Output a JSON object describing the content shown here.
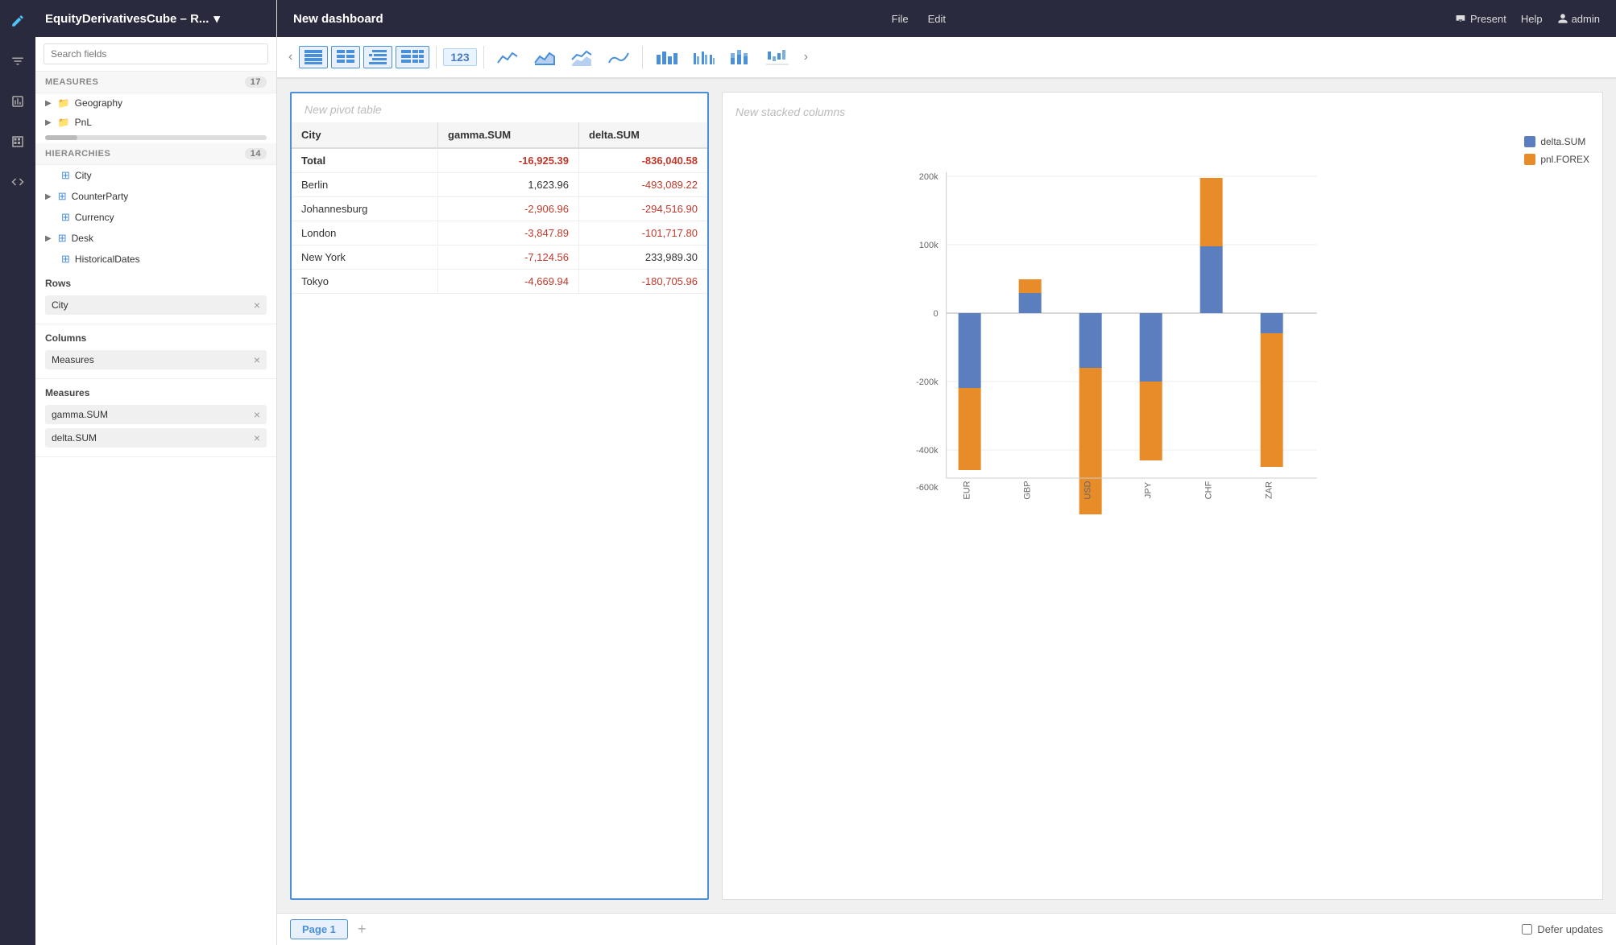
{
  "app": {
    "title": "New dashboard",
    "nav": {
      "file": "File",
      "edit": "Edit"
    },
    "top_right": {
      "present": "Present",
      "help": "Help",
      "admin": "admin"
    }
  },
  "sidebar": {
    "cube_name": "EquityDerivativesCube – R...",
    "search_placeholder": "Search fields",
    "measures_section": {
      "label": "MEASURES",
      "count": 17
    },
    "measures_items": [
      {
        "label": "Geography",
        "type": "folder",
        "expandable": true
      },
      {
        "label": "PnL",
        "type": "folder",
        "expandable": true
      }
    ],
    "hierarchies_section": {
      "label": "HIERARCHIES",
      "count": 14
    },
    "hierarchies_items": [
      {
        "label": "City",
        "type": "hierarchy",
        "expandable": false
      },
      {
        "label": "CounterParty",
        "type": "hierarchy",
        "expandable": true
      },
      {
        "label": "Currency",
        "type": "hierarchy",
        "expandable": false
      },
      {
        "label": "Desk",
        "type": "hierarchy",
        "expandable": true
      },
      {
        "label": "HistoricalDates",
        "type": "hierarchy",
        "expandable": false
      }
    ],
    "rows_section": {
      "title": "Rows",
      "chips": [
        {
          "label": "City"
        }
      ]
    },
    "columns_section": {
      "title": "Columns",
      "chips": [
        {
          "label": "Measures"
        }
      ]
    },
    "measures_chips_section": {
      "title": "Measures",
      "chips": [
        {
          "label": "gamma.SUM"
        },
        {
          "label": "delta.SUM"
        }
      ]
    }
  },
  "pivot": {
    "title": "New pivot table",
    "columns": [
      "City",
      "gamma.SUM",
      "delta.SUM"
    ],
    "rows": [
      {
        "city": "Total",
        "gamma": "-16,925.39",
        "delta": "-836,040.58",
        "gamma_neg": true,
        "delta_neg": true
      },
      {
        "city": "Berlin",
        "gamma": "1,623.96",
        "delta": "-493,089.22",
        "gamma_neg": false,
        "delta_neg": true
      },
      {
        "city": "Johannesburg",
        "gamma": "-2,906.96",
        "delta": "-294,516.90",
        "gamma_neg": true,
        "delta_neg": true
      },
      {
        "city": "London",
        "gamma": "-3,847.89",
        "delta": "-101,717.80",
        "gamma_neg": true,
        "delta_neg": true
      },
      {
        "city": "New York",
        "gamma": "-7,124.56",
        "delta": "233,989.30",
        "gamma_neg": true,
        "delta_neg": false
      },
      {
        "city": "Tokyo",
        "gamma": "-4,669.94",
        "delta": "-180,705.96",
        "gamma_neg": true,
        "delta_neg": true
      }
    ]
  },
  "chart": {
    "title": "New stacked columns",
    "legend": [
      {
        "label": "delta.SUM",
        "color": "#5b7fbe"
      },
      {
        "label": "pnl.FOREX",
        "color": "#e88c2a"
      }
    ],
    "x_labels": [
      "EUR",
      "GBP",
      "USD",
      "JPY",
      "CHF",
      "ZAR"
    ],
    "y_labels": [
      "200k",
      "0",
      "-200k",
      "-400k",
      "-600k"
    ],
    "bars": [
      {
        "x_label": "EUR",
        "delta": -220000,
        "forex": -240000
      },
      {
        "x_label": "GBP",
        "delta": 60000,
        "forex": 50000
      },
      {
        "x_label": "USD",
        "delta": -160000,
        "forex": -490000
      },
      {
        "x_label": "JPY",
        "delta": -200000,
        "forex": -230000
      },
      {
        "x_label": "CHF",
        "delta": 195000,
        "forex": 200000
      },
      {
        "x_label": "ZAR",
        "delta": -60000,
        "forex": -390000
      }
    ]
  },
  "bottom": {
    "page_tab": "Page 1",
    "add_page": "+",
    "defer_label": "Defer updates"
  },
  "toolbar": {
    "nav_left": "‹",
    "nav_right": "›",
    "num_icon": "123"
  }
}
